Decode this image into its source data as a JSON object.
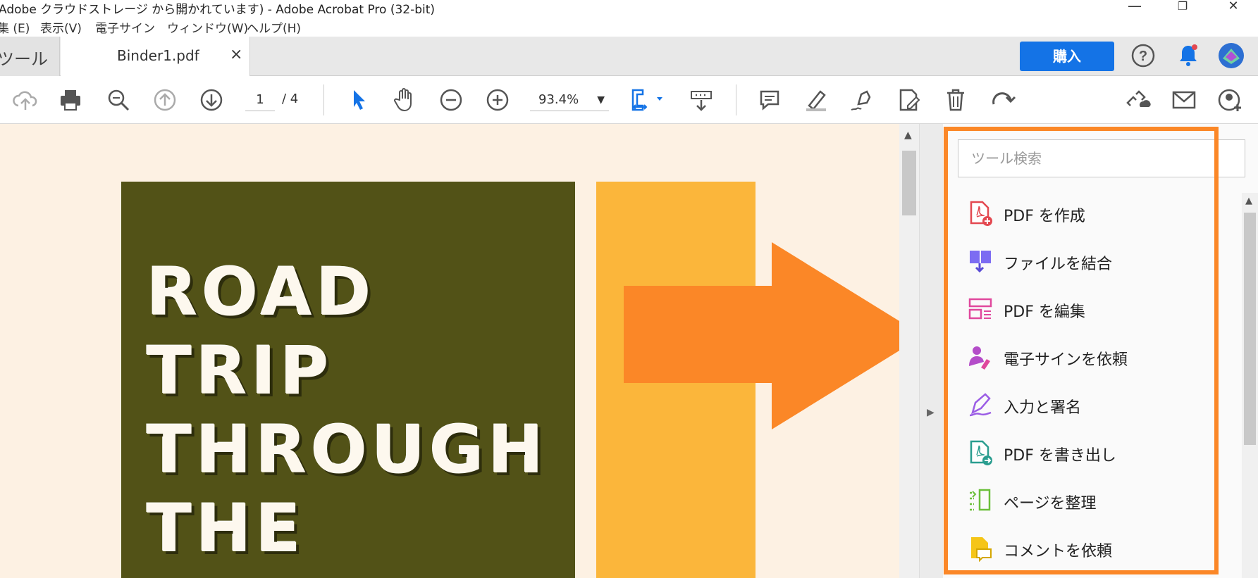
{
  "window": {
    "title": "Adobe クラウドストレージ から開かれています) - Adobe Acrobat Pro (32-bit)",
    "controls": [
      "—",
      "❐",
      "✕"
    ]
  },
  "menu": [
    "集 (E)",
    "表示(V)",
    "電子サイン",
    "ウィンドウ(W)",
    "ヘルプ(H)"
  ],
  "tabs": {
    "home_label": "ツール",
    "doc_label": "Binder1.pdf",
    "close": "×"
  },
  "header": {
    "buy_label": "購入"
  },
  "toolbar": {
    "page_current": "1",
    "page_total": "/ 4",
    "zoom": "93.4%",
    "zoom_caret": "▼"
  },
  "document": {
    "lines": [
      "ROAD",
      "TRIP",
      "THROUGH",
      "THE"
    ],
    "colors": {
      "background": "#fdf1e3",
      "green": "#525217",
      "yellow": "#fbb63b",
      "arrow": "#fb8727"
    }
  },
  "right_panel": {
    "search_placeholder": "ツール検索",
    "tools": [
      {
        "label": "PDF を作成",
        "icon": "create-pdf-icon"
      },
      {
        "label": "ファイルを結合",
        "icon": "combine-files-icon"
      },
      {
        "label": "PDF を編集",
        "icon": "edit-pdf-icon"
      },
      {
        "label": "電子サインを依頼",
        "icon": "request-signature-icon"
      },
      {
        "label": "入力と署名",
        "icon": "fill-sign-icon"
      },
      {
        "label": "PDF を書き出し",
        "icon": "export-pdf-icon"
      },
      {
        "label": "ページを整理",
        "icon": "organize-pages-icon"
      },
      {
        "label": "コメントを依頼",
        "icon": "request-comments-icon"
      }
    ],
    "highlight_color": "#fb8727"
  }
}
